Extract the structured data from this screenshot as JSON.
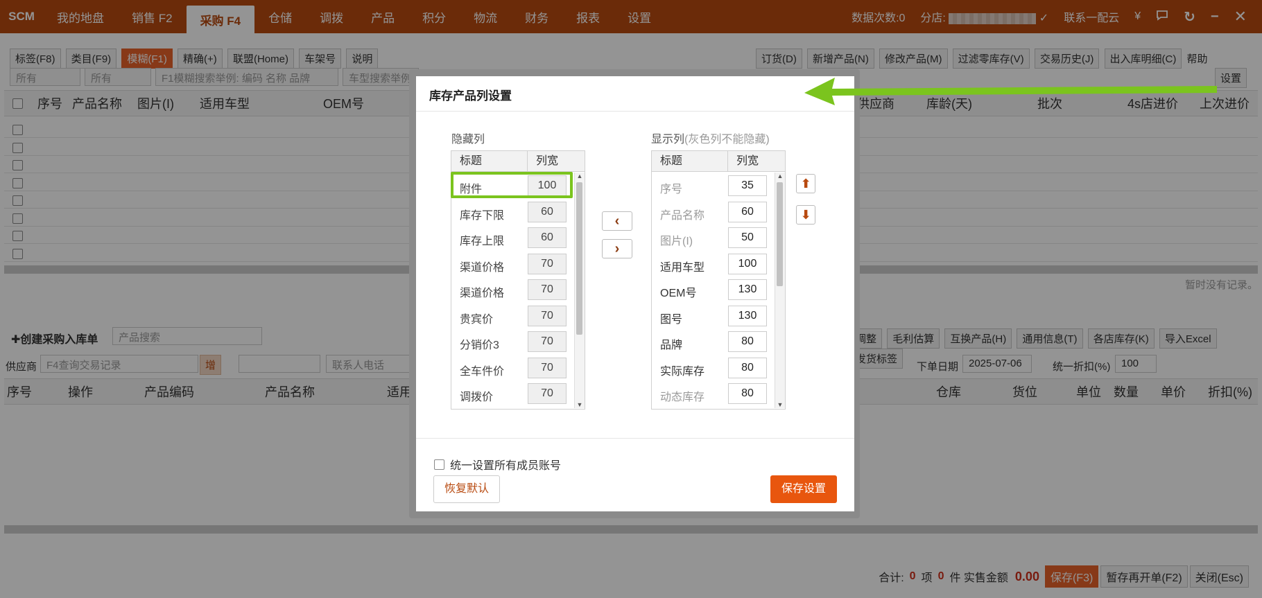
{
  "topbar": {
    "logo": "SCM",
    "nav": [
      "我的地盘",
      "销售 F2",
      "采购 F4",
      "仓储",
      "调拨",
      "产品",
      "积分",
      "物流",
      "财务",
      "报表",
      "设置"
    ],
    "active_index": 2,
    "data_count": "数据次数:0",
    "branch_label": "分店:",
    "contact": "联系一配云",
    "yen": "¥"
  },
  "toolbar": {
    "tag_dropdown": "标签(F8)",
    "category_dropdown": "类目(F9)",
    "fuzzy": "模糊(F1)",
    "precise": "精确(+)",
    "alliance": "联盟(Home)",
    "shelf": "车架号",
    "explain": "说明",
    "right_buttons": [
      "订货(D)",
      "新增产品(N)",
      "修改产品(M)",
      "过滤零库存(V)",
      "交易历史(J)",
      "出入库明细(C)"
    ],
    "help": "帮助",
    "settings": "设置",
    "all1": "所有",
    "all2": "所有",
    "search_placeholder": "F1模糊搜索举例: 编码 名称 品牌",
    "car_search_placeholder": "车型搜索举例"
  },
  "upper_table": {
    "columns": [
      "序号",
      "产品名称",
      "图片(I)",
      "适用车型",
      "OEM号",
      "供应商",
      "库龄(天)",
      "批次",
      "4s店进价",
      "上次进价"
    ],
    "empty_text": "暂时没有记录。"
  },
  "purchase": {
    "create_label": "✚创建采购入库单",
    "product_search_placeholder": "产品搜索",
    "supplier_label": "供应商",
    "supplier_placeholder": "F4查询交易记录",
    "add_button": "增",
    "contact_placeholder": "联系人电话",
    "order_date_label": "下单日期",
    "order_date": "2025-07-06",
    "discount_label": "统一折扣(%)",
    "discount": "100",
    "right_buttons": [
      "调整",
      "毛利估算",
      "互换产品(H)",
      "通用信息(T)",
      "各店库存(K)",
      "导入Excel",
      "发货标签"
    ],
    "columns": [
      "序号",
      "操作",
      "产品编码",
      "产品名称",
      "适用",
      "仓库",
      "货位",
      "单位",
      "数量",
      "单价",
      "折扣(%)"
    ]
  },
  "footer": {
    "total_label": "合计:",
    "items": "0",
    "items_unit": "项",
    "pieces": "0",
    "pieces_unit": "件 实售金额",
    "amount": "0.00",
    "save": "保存(F3)",
    "save_reopen": "暂存再开单(F2)",
    "close": "关闭(Esc)"
  },
  "modal": {
    "title": "库存产品列设置",
    "hidden_title": "隐藏列",
    "visible_title": "显示列",
    "visible_note": "(灰色列不能隐藏)",
    "col_header": "标题",
    "width_header": "列宽",
    "hidden_rows": [
      {
        "label": "附件",
        "width": "100"
      },
      {
        "label": "库存下限",
        "width": "60"
      },
      {
        "label": "库存上限",
        "width": "60"
      },
      {
        "label": "渠道价格",
        "width": "70"
      },
      {
        "label": "渠道价格",
        "width": "70"
      },
      {
        "label": "贵宾价",
        "width": "70"
      },
      {
        "label": "分销价3",
        "width": "70"
      },
      {
        "label": "全车件价",
        "width": "70"
      },
      {
        "label": "调拨价",
        "width": "70"
      }
    ],
    "visible_rows": [
      {
        "label": "序号",
        "width": "35",
        "readonly": true
      },
      {
        "label": "产品名称",
        "width": "60",
        "readonly": true
      },
      {
        "label": "图片(I)",
        "width": "50",
        "readonly": true
      },
      {
        "label": "适用车型",
        "width": "100",
        "readonly": false
      },
      {
        "label": "OEM号",
        "width": "130",
        "readonly": false
      },
      {
        "label": "图号",
        "width": "130",
        "readonly": false
      },
      {
        "label": "品牌",
        "width": "80",
        "readonly": false
      },
      {
        "label": "实际库存",
        "width": "80",
        "readonly": false
      },
      {
        "label": "动态库存",
        "width": "80",
        "readonly": true
      }
    ],
    "move_left": "‹",
    "move_right": "›",
    "move_up": "⬆",
    "move_down": "⬇",
    "apply_all_label": "统一设置所有成员账号",
    "restore_default": "恢复默认",
    "save_settings": "保存设置"
  },
  "colors": {
    "brand": "#b84a10",
    "accent": "#e8622a",
    "highlight": "#7bc41e"
  }
}
